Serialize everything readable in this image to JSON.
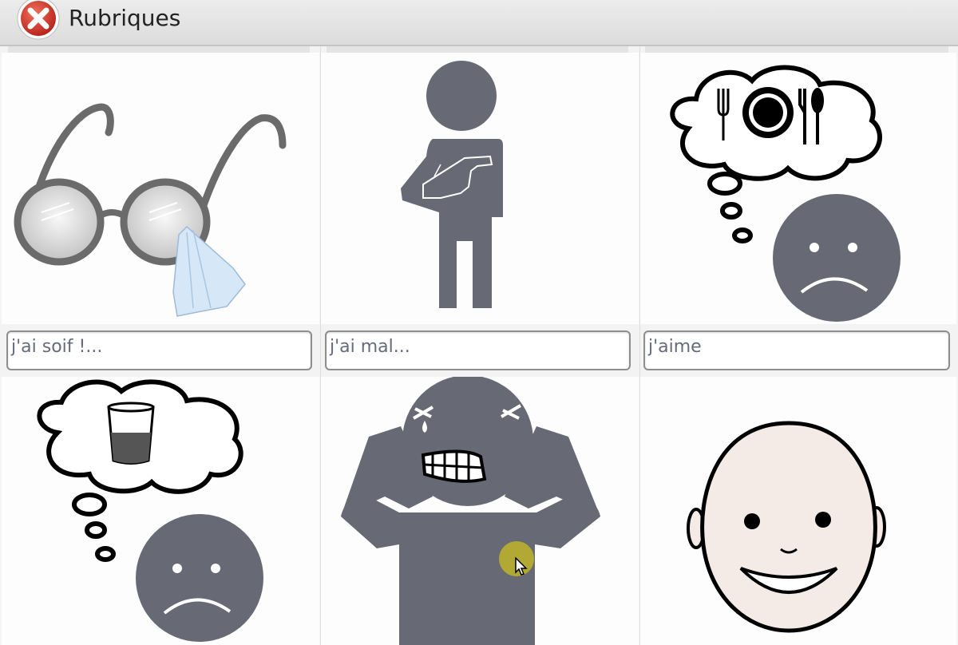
{
  "header": {
    "title": "Rubriques",
    "close_icon": "close-icon"
  },
  "colors": {
    "pictogram_gray": "#676a74",
    "field_border": "#8e8e8e",
    "field_text": "#666a7d",
    "close_red": "#d63a2e",
    "cursor_highlight": "#beb428"
  },
  "cards": [
    {
      "pictogram": "glasses-cleaning-icon",
      "label": ""
    },
    {
      "pictogram": "person-pointing-self-icon",
      "label": ""
    },
    {
      "pictogram": "hungry-sad-face-icon",
      "label": ""
    },
    {
      "pictogram": "thirsty-sad-face-icon",
      "label": "j'ai soif !..."
    },
    {
      "pictogram": "person-in-pain-icon",
      "label": "j'ai mal..."
    },
    {
      "pictogram": "happy-face-icon",
      "label": "j'aime"
    }
  ]
}
